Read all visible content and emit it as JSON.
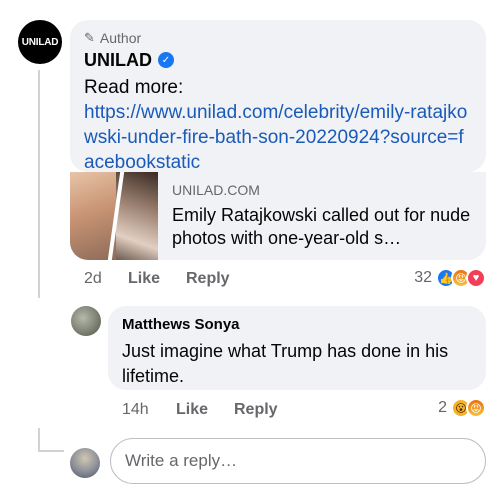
{
  "post_comment": {
    "author_badge": "Author",
    "author_name": "UNILAD",
    "avatar_text": "UNILAD",
    "text": "Read more:",
    "link": "https://www.unilad.com/celebrity/emily-ratajkowski-under-fire-bath-son-20220924?source=facebookstatic",
    "preview": {
      "domain": "UNILAD.COM",
      "title": "Emily Ratajkowski called out for nude photos with one-year-old s…"
    },
    "time": "2d",
    "like_label": "Like",
    "reply_label": "Reply",
    "reaction_count": "32",
    "reactions": [
      "like-reaction-icon",
      "angry-reaction-icon",
      "love-reaction-icon"
    ]
  },
  "reply_comment": {
    "author_name": "Matthews Sonya",
    "text": "Just imagine what Trump has done in his lifetime.",
    "time": "14h",
    "like_label": "Like",
    "reply_label": "Reply",
    "reaction_count": "2",
    "reactions": [
      "wow-reaction-icon",
      "angry-reaction-icon"
    ]
  },
  "composer": {
    "placeholder": "Write a reply…"
  },
  "colors": {
    "bubble": "#f0f2f5",
    "link": "#1a5ab8",
    "secondary_text": "#65676b",
    "verified": "#1877f2"
  }
}
